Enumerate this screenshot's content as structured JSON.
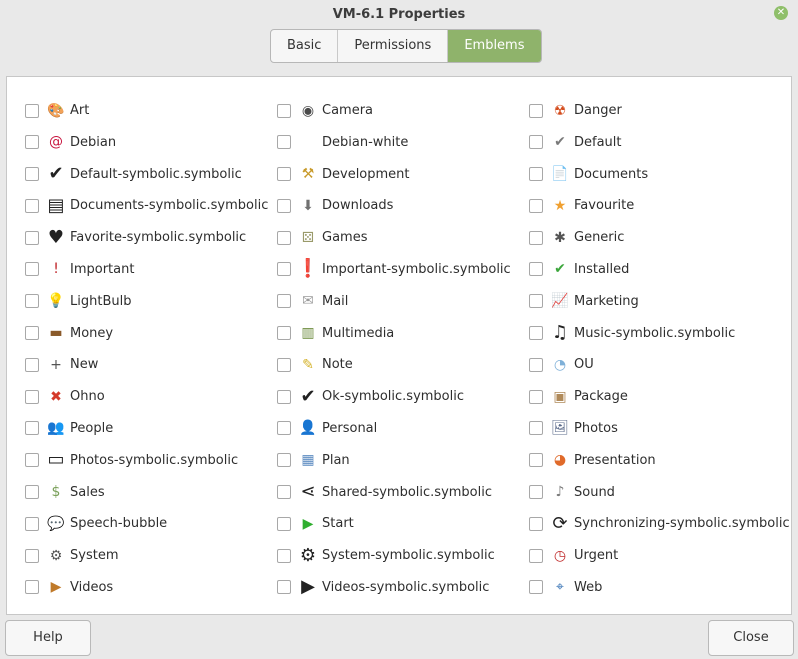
{
  "window": {
    "title": "VM-6.1 Properties"
  },
  "tabs": [
    {
      "label": "Basic"
    },
    {
      "label": "Permissions"
    },
    {
      "label": "Emblems"
    }
  ],
  "emblems": [
    {
      "label": "Art",
      "icon": "art-icon",
      "glyph": "🎨",
      "color": "#e24b4b"
    },
    {
      "label": "Camera",
      "icon": "camera-icon",
      "glyph": "◉",
      "color": "#4a4a4a"
    },
    {
      "label": "Danger",
      "icon": "danger-icon",
      "glyph": "☢",
      "color": "#d44d1e"
    },
    {
      "label": "Debian",
      "icon": "debian-icon",
      "glyph": "@",
      "color": "#c8163f"
    },
    {
      "label": "Debian-white",
      "icon": "debian-white-icon",
      "glyph": "",
      "color": "#ffffff"
    },
    {
      "label": "Default",
      "icon": "default-icon",
      "glyph": "✔",
      "color": "#7a7a7a"
    },
    {
      "label": "Default-symbolic.symbolic",
      "icon": "default-symbolic-icon",
      "glyph": "✔",
      "color": "#222222"
    },
    {
      "label": "Development",
      "icon": "development-icon",
      "glyph": "⚒",
      "color": "#c89a2a"
    },
    {
      "label": "Documents",
      "icon": "documents-icon",
      "glyph": "📄",
      "color": "#6a7fb0"
    },
    {
      "label": "Documents-symbolic.symbolic",
      "icon": "documents-symbolic-icon",
      "glyph": "▤",
      "color": "#222222"
    },
    {
      "label": "Downloads",
      "icon": "downloads-icon",
      "glyph": "⬇",
      "color": "#707070"
    },
    {
      "label": "Favourite",
      "icon": "favourite-icon",
      "glyph": "★",
      "color": "#f0a030"
    },
    {
      "label": "Favorite-symbolic.symbolic",
      "icon": "favorite-symbolic-icon",
      "glyph": "♥",
      "color": "#222222"
    },
    {
      "label": "Games",
      "icon": "games-icon",
      "glyph": "⚄",
      "color": "#9a9a6a"
    },
    {
      "label": "Generic",
      "icon": "generic-icon",
      "glyph": "✱",
      "color": "#555555"
    },
    {
      "label": "Important",
      "icon": "important-icon",
      "glyph": "!",
      "color": "#c0262a"
    },
    {
      "label": "Important-symbolic.symbolic",
      "icon": "important-symbolic-icon",
      "glyph": "❗",
      "color": "#222222"
    },
    {
      "label": "Installed",
      "icon": "installed-icon",
      "glyph": "✔",
      "color": "#3ca63c"
    },
    {
      "label": "LightBulb",
      "icon": "lightbulb-icon",
      "glyph": "💡",
      "color": "#cfcfcf"
    },
    {
      "label": "Mail",
      "icon": "mail-icon",
      "glyph": "✉",
      "color": "#9a9a9a"
    },
    {
      "label": "Marketing",
      "icon": "marketing-icon",
      "glyph": "📈",
      "color": "#5a7fa8"
    },
    {
      "label": "Money",
      "icon": "money-icon",
      "glyph": "▬",
      "color": "#8a5a2a"
    },
    {
      "label": "Multimedia",
      "icon": "multimedia-icon",
      "glyph": "▥",
      "color": "#6a8a3a"
    },
    {
      "label": "Music-symbolic.symbolic",
      "icon": "music-symbolic-icon",
      "glyph": "♫",
      "color": "#222222"
    },
    {
      "label": "New",
      "icon": "new-icon",
      "glyph": "+",
      "color": "#555555"
    },
    {
      "label": "Note",
      "icon": "note-icon",
      "glyph": "✎",
      "color": "#d4b22a"
    },
    {
      "label": "OU",
      "icon": "ou-icon",
      "glyph": "◔",
      "color": "#7fb0d8"
    },
    {
      "label": "Ohno",
      "icon": "ohno-icon",
      "glyph": "✖",
      "color": "#d43a2a"
    },
    {
      "label": "Ok-symbolic.symbolic",
      "icon": "ok-symbolic-icon",
      "glyph": "✔",
      "color": "#222222"
    },
    {
      "label": "Package",
      "icon": "package-icon",
      "glyph": "▣",
      "color": "#b08a5a"
    },
    {
      "label": "People",
      "icon": "people-icon",
      "glyph": "👥",
      "color": "#8a8a8a"
    },
    {
      "label": "Personal",
      "icon": "personal-icon",
      "glyph": "👤",
      "color": "#7a7a7a"
    },
    {
      "label": "Photos",
      "icon": "photos-icon",
      "glyph": "🖼",
      "color": "#5a6a8a"
    },
    {
      "label": "Photos-symbolic.symbolic",
      "icon": "photos-symbolic-icon",
      "glyph": "▭",
      "color": "#222222"
    },
    {
      "label": "Plan",
      "icon": "plan-icon",
      "glyph": "▦",
      "color": "#5a8ac0"
    },
    {
      "label": "Presentation",
      "icon": "presentation-icon",
      "glyph": "◕",
      "color": "#e06a2a"
    },
    {
      "label": "Sales",
      "icon": "sales-icon",
      "glyph": "$",
      "color": "#7aa05a"
    },
    {
      "label": "Shared-symbolic.symbolic",
      "icon": "shared-symbolic-icon",
      "glyph": "⋖",
      "color": "#222222"
    },
    {
      "label": "Sound",
      "icon": "sound-icon",
      "glyph": "♪",
      "color": "#7a7a7a"
    },
    {
      "label": "Speech-bubble",
      "icon": "speech-bubble-icon",
      "glyph": "💬",
      "color": "#b0b0b0"
    },
    {
      "label": "Start",
      "icon": "start-icon",
      "glyph": "▶",
      "color": "#2fae2f"
    },
    {
      "label": "Synchronizing-symbolic.symbolic",
      "icon": "synchronizing-symbolic-icon",
      "glyph": "⟳",
      "color": "#222222"
    },
    {
      "label": "System",
      "icon": "system-icon",
      "glyph": "⚙",
      "color": "#555555"
    },
    {
      "label": "System-symbolic.symbolic",
      "icon": "system-symbolic-icon",
      "glyph": "⚙",
      "color": "#222222"
    },
    {
      "label": "Urgent",
      "icon": "urgent-icon",
      "glyph": "◷",
      "color": "#c02a2a"
    },
    {
      "label": "Videos",
      "icon": "videos-icon",
      "glyph": "▶",
      "color": "#c07a2a"
    },
    {
      "label": "Videos-symbolic.symbolic",
      "icon": "videos-symbolic-icon",
      "glyph": "▶",
      "color": "#222222"
    },
    {
      "label": "Web",
      "icon": "web-icon",
      "glyph": "⌖",
      "color": "#2a6ab0"
    }
  ],
  "footer": {
    "help_label": "Help",
    "close_label": "Close"
  }
}
